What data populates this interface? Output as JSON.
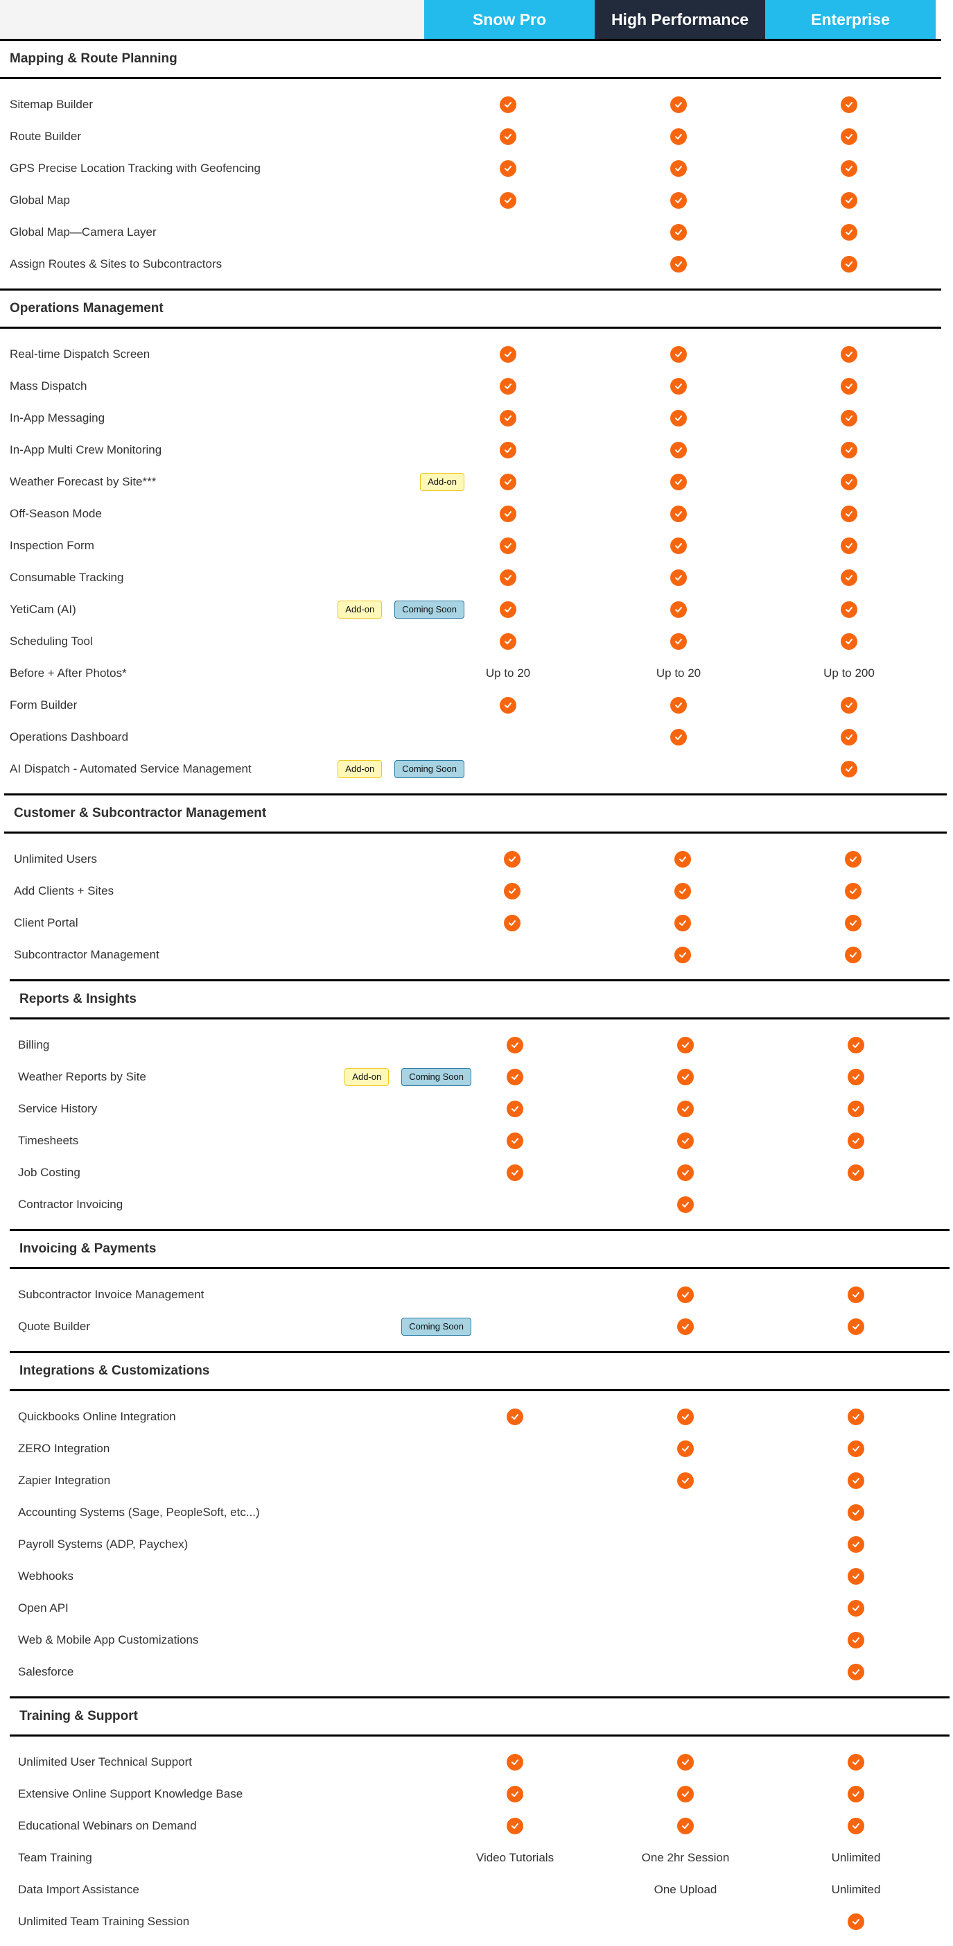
{
  "plans": [
    "Snow Pro",
    "High Performance",
    "Enterprise"
  ],
  "colors": {
    "plan_light": "#23bbec",
    "plan_dark": "#222b3c",
    "check": "#f7660f",
    "addon_bg": "#fff8b8",
    "soon_bg": "#a7d3e3"
  },
  "badge_labels": {
    "addon": "Add-on",
    "soon": "Coming Soon"
  },
  "sections": [
    {
      "title": "Mapping & Route Planning",
      "rows": [
        {
          "label": "Sitemap Builder",
          "badges": [],
          "values": [
            "check",
            "check",
            "check"
          ]
        },
        {
          "label": "Route Builder",
          "badges": [],
          "values": [
            "check",
            "check",
            "check"
          ]
        },
        {
          "label": "GPS Precise Location Tracking with Geofencing",
          "badges": [],
          "values": [
            "check",
            "check",
            "check"
          ]
        },
        {
          "label": "Global Map",
          "badges": [],
          "values": [
            "check",
            "check",
            "check"
          ]
        },
        {
          "label": "Global Map—Camera Layer",
          "badges": [],
          "values": [
            "",
            "check",
            "check"
          ]
        },
        {
          "label": "Assign Routes & Sites to Subcontractors",
          "badges": [],
          "values": [
            "",
            "check",
            "check"
          ]
        }
      ]
    },
    {
      "title": "Operations Management",
      "rows": [
        {
          "label": "Real-time Dispatch Screen",
          "badges": [],
          "values": [
            "check",
            "check",
            "check"
          ]
        },
        {
          "label": "Mass Dispatch",
          "badges": [],
          "values": [
            "check",
            "check",
            "check"
          ]
        },
        {
          "label": "In-App Messaging",
          "badges": [],
          "values": [
            "check",
            "check",
            "check"
          ]
        },
        {
          "label": "In-App Multi Crew Monitoring",
          "badges": [],
          "values": [
            "check",
            "check",
            "check"
          ]
        },
        {
          "label": "Weather Forecast by Site***",
          "badges": [
            "Add-on"
          ],
          "values": [
            "check",
            "check",
            "check"
          ]
        },
        {
          "label": "Off-Season Mode",
          "badges": [],
          "values": [
            "check",
            "check",
            "check"
          ]
        },
        {
          "label": "Inspection Form",
          "badges": [],
          "values": [
            "check",
            "check",
            "check"
          ]
        },
        {
          "label": "Consumable Tracking",
          "badges": [],
          "values": [
            "check",
            "check",
            "check"
          ]
        },
        {
          "label": "YetiCam (AI)",
          "badges": [
            "Add-on",
            "Coming Soon"
          ],
          "values": [
            "check",
            "check",
            "check"
          ]
        },
        {
          "label": "Scheduling Tool",
          "badges": [],
          "values": [
            "check",
            "check",
            "check"
          ]
        },
        {
          "label": "Before + After Photos*",
          "badges": [],
          "values": [
            "Up to 20",
            "Up to 20",
            "Up to 200"
          ]
        },
        {
          "label": "Form Builder",
          "badges": [],
          "values": [
            "check",
            "check",
            "check"
          ]
        },
        {
          "label": "Operations Dashboard",
          "badges": [],
          "values": [
            "",
            "check",
            "check"
          ]
        },
        {
          "label": "AI Dispatch - Automated Service Management",
          "badges": [
            "Add-on",
            "Coming Soon"
          ],
          "values": [
            "",
            "",
            "check"
          ]
        }
      ]
    },
    {
      "title": "Customer & Subcontractor Management",
      "rows": [
        {
          "label": "Unlimited Users",
          "badges": [],
          "values": [
            "check",
            "check",
            "check"
          ]
        },
        {
          "label": "Add Clients + Sites",
          "badges": [],
          "values": [
            "check",
            "check",
            "check"
          ]
        },
        {
          "label": "Client Portal",
          "badges": [],
          "values": [
            "check",
            "check",
            "check"
          ]
        },
        {
          "label": "Subcontractor Management",
          "badges": [],
          "values": [
            "",
            "check",
            "check"
          ]
        }
      ]
    },
    {
      "title": "Reports & Insights",
      "rows": [
        {
          "label": "Billing",
          "badges": [],
          "values": [
            "check",
            "check",
            "check"
          ]
        },
        {
          "label": "Weather Reports by Site",
          "badges": [
            "Add-on",
            "Coming Soon"
          ],
          "values": [
            "check",
            "check",
            "check"
          ]
        },
        {
          "label": "Service History",
          "badges": [],
          "values": [
            "check",
            "check",
            "check"
          ]
        },
        {
          "label": "Timesheets",
          "badges": [],
          "values": [
            "check",
            "check",
            "check"
          ]
        },
        {
          "label": "Job Costing",
          "badges": [],
          "values": [
            "check",
            "check",
            "check"
          ]
        },
        {
          "label": "Contractor Invoicing",
          "badges": [],
          "values": [
            "",
            "check",
            ""
          ]
        }
      ]
    },
    {
      "title": "Invoicing & Payments",
      "rows": [
        {
          "label": "Subcontractor Invoice Management",
          "badges": [],
          "values": [
            "",
            "check",
            "check"
          ]
        },
        {
          "label": "Quote Builder",
          "badges": [
            "Coming Soon"
          ],
          "values": [
            "",
            "check",
            "check"
          ]
        }
      ]
    },
    {
      "title": "Integrations & Customizations",
      "rows": [
        {
          "label": "Quickbooks Online Integration",
          "badges": [],
          "values": [
            "check",
            "check",
            "check"
          ]
        },
        {
          "label": "ZERO Integration",
          "badges": [],
          "values": [
            "",
            "check",
            "check"
          ]
        },
        {
          "label": "Zapier Integration",
          "badges": [],
          "values": [
            "",
            "check",
            "check"
          ]
        },
        {
          "label": "Accounting Systems (Sage, PeopleSoft, etc...)",
          "badges": [],
          "values": [
            "",
            "",
            "check"
          ]
        },
        {
          "label": "Payroll Systems (ADP, Paychex)",
          "badges": [],
          "values": [
            "",
            "",
            "check"
          ]
        },
        {
          "label": "Webhooks",
          "badges": [],
          "values": [
            "",
            "",
            "check"
          ]
        },
        {
          "label": "Open API",
          "badges": [],
          "values": [
            "",
            "",
            "check"
          ]
        },
        {
          "label": "Web & Mobile App Customizations",
          "badges": [],
          "values": [
            "",
            "",
            "check"
          ]
        },
        {
          "label": "Salesforce",
          "badges": [],
          "values": [
            "",
            "",
            "check"
          ]
        }
      ]
    },
    {
      "title": "Training & Support",
      "rows": [
        {
          "label": "Unlimited User Technical Support",
          "badges": [],
          "values": [
            "check",
            "check",
            "check"
          ]
        },
        {
          "label": "Extensive Online Support Knowledge Base",
          "badges": [],
          "values": [
            "check",
            "check",
            "check"
          ]
        },
        {
          "label": "Educational Webinars on Demand",
          "badges": [],
          "values": [
            "check",
            "check",
            "check"
          ]
        },
        {
          "label": "Team Training",
          "badges": [],
          "values": [
            "Video Tutorials",
            "One 2hr Session",
            "Unlimited"
          ]
        },
        {
          "label": "Data Import Assistance",
          "badges": [],
          "values": [
            "",
            "One Upload",
            "Unlimited"
          ]
        },
        {
          "label": "Unlimited Team Training Session",
          "badges": [],
          "values": [
            "",
            "",
            "check"
          ]
        }
      ]
    }
  ]
}
